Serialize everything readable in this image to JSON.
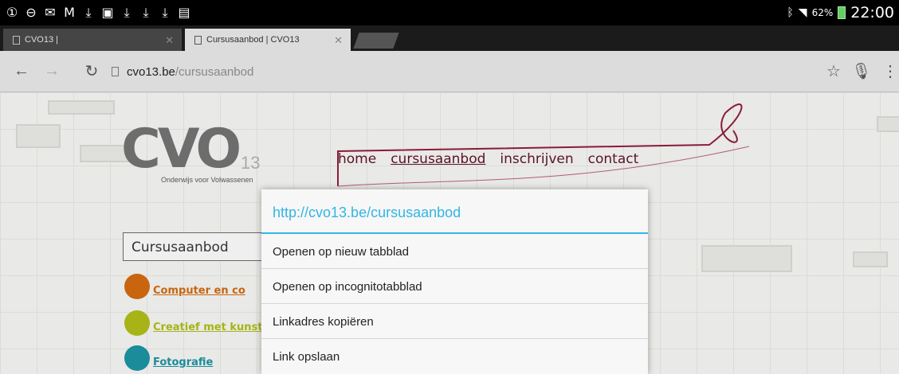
{
  "status_bar": {
    "notification_icons": [
      "sim-1-icon",
      "do-not-disturb-icon",
      "missed-email-icon",
      "gmail-icon",
      "download-icon",
      "image-icon",
      "download-icon",
      "download-icon",
      "download-icon",
      "shopping-bag-icon"
    ],
    "bluetooth_icon": "bluetooth-icon",
    "wifi_icon": "wifi-icon",
    "battery_percent": "62%",
    "time": "22:00"
  },
  "tabs": [
    {
      "title": "CVO13 |",
      "active": false
    },
    {
      "title": "Cursusaanbod | CVO13",
      "active": true
    }
  ],
  "toolbar": {
    "url_host": "cvo13.be",
    "url_path": "/cursusaanbod"
  },
  "page": {
    "logo_text": "CVO",
    "logo_number": "13",
    "logo_tagline": "Onderwijs voor Volwassenen",
    "nav": [
      "home",
      "cursusaanbod",
      "inschrijven",
      "contact"
    ],
    "section_title": "Cursusaanbod",
    "categories": [
      {
        "label": "Computer en co",
        "color": "#c8650e"
      },
      {
        "label": "Creatief met kunst",
        "color": "#a7b316"
      },
      {
        "label": "Fotografie",
        "color": "#1a8c9a"
      }
    ]
  },
  "dialog": {
    "title": "http://cvo13.be/cursusaanbod",
    "items": [
      "Openen op nieuw tabblad",
      "Openen op incognitotabblad",
      "Linkadres kopiëren",
      "Link opslaan"
    ]
  },
  "colors": {
    "accent_blue": "#33b5e5",
    "brand_maroon": "#8a1b3a"
  }
}
